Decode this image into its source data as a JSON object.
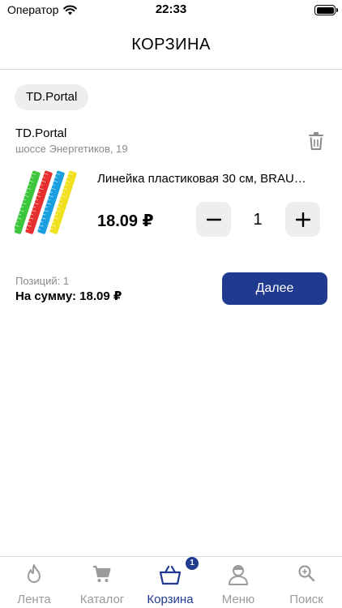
{
  "status_bar": {
    "carrier": "Оператор",
    "time": "22:33"
  },
  "header": {
    "title": "КОРЗИНА"
  },
  "store_chip": {
    "label": "TD.Portal"
  },
  "store": {
    "name": "TD.Portal",
    "address": "шоссе Энергетиков, 19"
  },
  "product": {
    "title": "Линейка пластиковая 30 см, BRAU…",
    "price": "18.09 ₽",
    "quantity": "1",
    "image_colors": [
      "#3cc63c",
      "#e63030",
      "#1aa0e0",
      "#f0e020"
    ]
  },
  "summary": {
    "positions": "Позиций: 1",
    "total": "На сумму: 18.09 ₽",
    "next_label": "Далее"
  },
  "tabs": [
    {
      "label": "Лента",
      "icon": "flame-icon",
      "active": false
    },
    {
      "label": "Каталог",
      "icon": "cart-icon",
      "active": false
    },
    {
      "label": "Корзина",
      "icon": "basket-icon",
      "active": true
    },
    {
      "label": "Меню",
      "icon": "user-icon",
      "active": false
    },
    {
      "label": "Поиск",
      "icon": "search-icon",
      "active": false
    }
  ],
  "cart_badge": "1",
  "colors": {
    "accent": "#1f3a8f",
    "inactive": "#9b9b9b",
    "chip_bg": "#eeeeee"
  }
}
